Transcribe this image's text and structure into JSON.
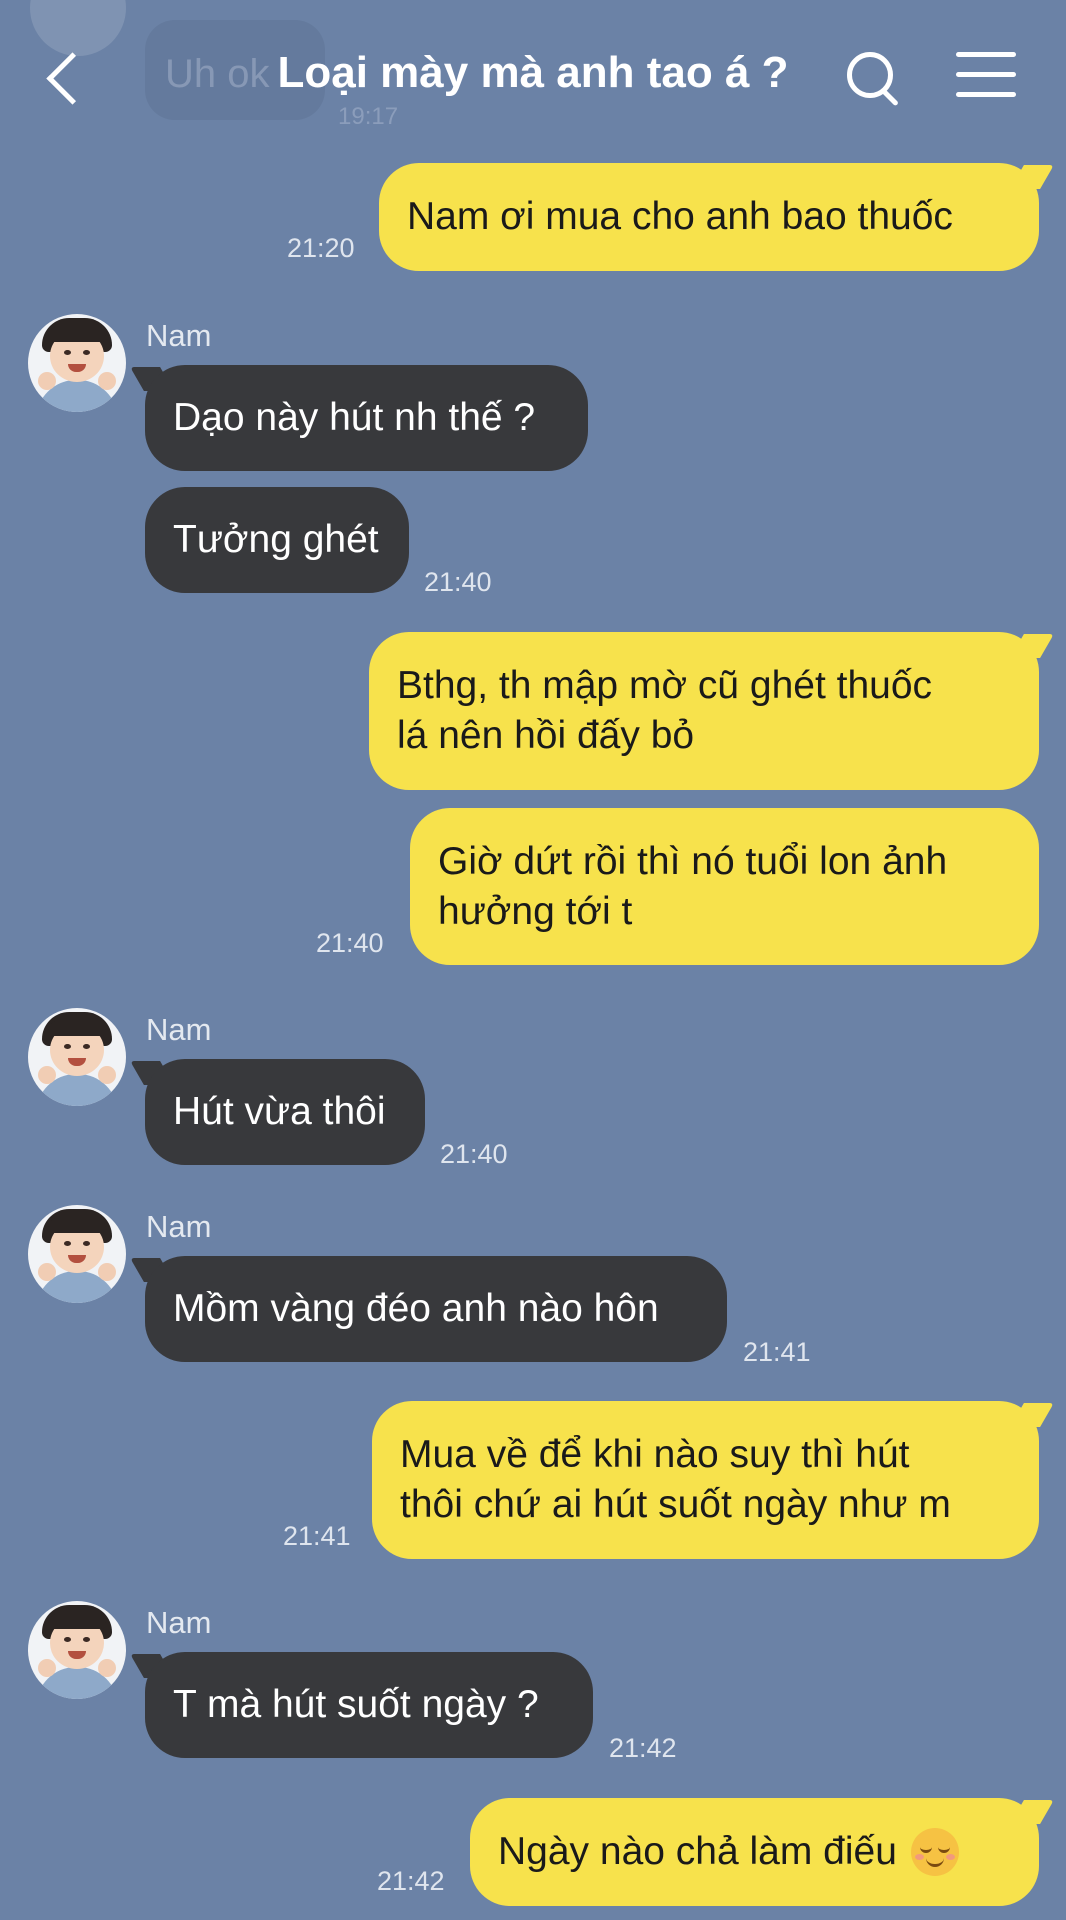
{
  "header": {
    "title": "Loại mày mà anh tao á ?",
    "ghost_message": "Uh ok",
    "ghost_time": "19:17",
    "back_icon": "chevron-left-icon",
    "search_icon": "search-icon",
    "menu_icon": "hamburger-menu-icon"
  },
  "colors": {
    "background": "#6b82a6",
    "incoming_bubble": "#38393c",
    "outgoing_bubble": "#f7e24c"
  },
  "messages": [
    {
      "id": "m1",
      "direction": "out",
      "text": "Nam ơi mua cho anh bao thuốc",
      "time": "21:20"
    },
    {
      "id": "m2",
      "direction": "in",
      "sender": "Nam",
      "text": "Dạo này hút nh thế ?"
    },
    {
      "id": "m3",
      "direction": "in",
      "text": "Tưởng ghét",
      "time": "21:40"
    },
    {
      "id": "m4",
      "direction": "out",
      "lines": [
        "Bthg, th mập mờ cũ ghét thuốc",
        "lá nên hồi đấy bỏ"
      ]
    },
    {
      "id": "m5",
      "direction": "out",
      "lines": [
        "Giờ dứt rồi thì nó tuổi lon ảnh",
        "hưởng tới t"
      ],
      "time": "21:40"
    },
    {
      "id": "m6",
      "direction": "in",
      "sender": "Nam",
      "text": "Hút vừa thôi",
      "time": "21:40"
    },
    {
      "id": "m7",
      "direction": "in",
      "sender": "Nam",
      "text": "Mồm vàng đéo anh nào hôn",
      "time": "21:41"
    },
    {
      "id": "m8",
      "direction": "out",
      "lines": [
        "Mua về để khi nào suy thì hút",
        "thôi chứ ai hút suốt ngày như m"
      ],
      "time": "21:41"
    },
    {
      "id": "m9",
      "direction": "in",
      "sender": "Nam",
      "text": "T mà hút suốt ngày ?",
      "time": "21:42"
    },
    {
      "id": "m10",
      "direction": "out",
      "text": "Ngày nào chả làm điếu",
      "emoji": "relieved-face-emoji",
      "time": "21:42"
    }
  ]
}
